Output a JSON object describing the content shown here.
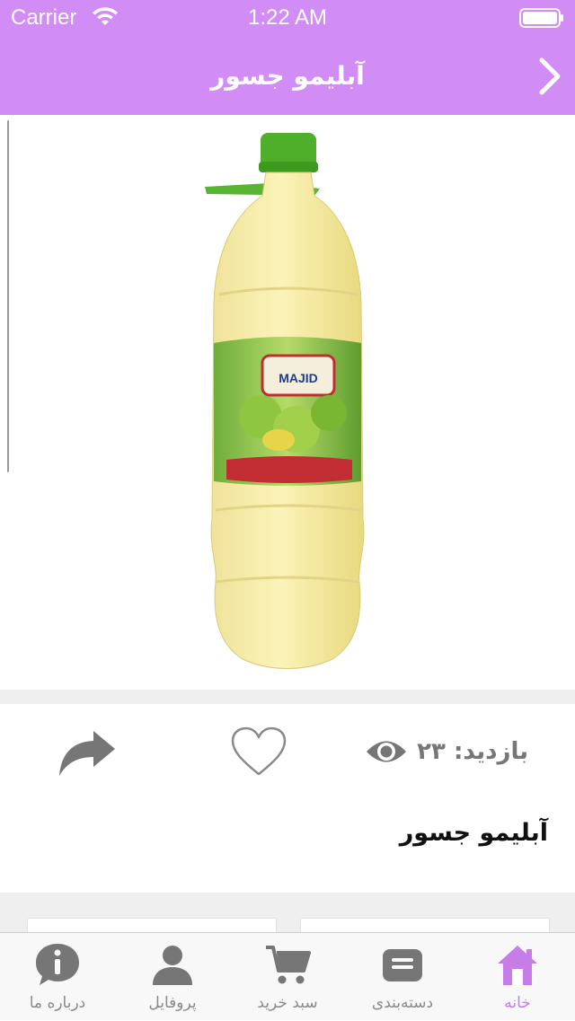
{
  "status_bar": {
    "carrier": "Carrier",
    "time": "1:22 AM"
  },
  "nav": {
    "title": "آبلیمو جسور"
  },
  "product": {
    "name": "آبلیمو جسور",
    "views_label": "بازدید: ۲۳",
    "image_alt": "MAJID"
  },
  "tabs": [
    {
      "label": "خانه",
      "icon": "home-icon",
      "active": true
    },
    {
      "label": "دسته‌بندی",
      "icon": "category-icon",
      "active": false
    },
    {
      "label": "سبد خرید",
      "icon": "cart-icon",
      "active": false
    },
    {
      "label": "پروفایل",
      "icon": "profile-icon",
      "active": false
    },
    {
      "label": "درباره ما",
      "icon": "info-icon",
      "active": false
    }
  ],
  "colors": {
    "accent": "#d18cf5",
    "active_tab": "#c67de8",
    "icon_gray": "#767676"
  }
}
